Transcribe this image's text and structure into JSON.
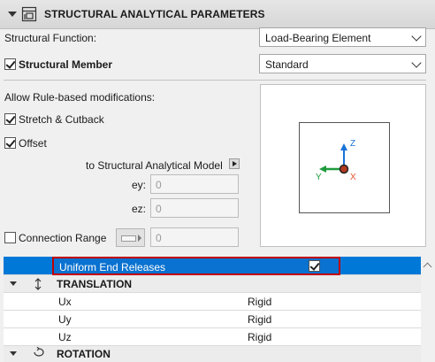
{
  "header": {
    "title": "STRUCTURAL ANALYTICAL PARAMETERS",
    "icon": "structural-panel-icon"
  },
  "structural_function": {
    "label": "Structural Function:",
    "value": "Load-Bearing Element"
  },
  "structural_member": {
    "label": "Structural Member",
    "checked": true,
    "value": "Standard"
  },
  "rule_based": {
    "label": "Allow Rule-based modifications:",
    "stretch_cutback": {
      "label": "Stretch & Cutback",
      "checked": true
    },
    "offset": {
      "label": "Offset",
      "checked": true
    },
    "to_model_label": "to Structural Analytical Model",
    "ey": {
      "label": "ey:",
      "value": "0"
    },
    "ez": {
      "label": "ez:",
      "value": "0"
    }
  },
  "connection_range": {
    "label": "Connection Range",
    "checked": false,
    "value": "0"
  },
  "preview": {
    "axis_z": "Z",
    "axis_y": "Y",
    "axis_x": "X"
  },
  "table": {
    "selected_row": {
      "label": "Uniform End Releases",
      "checked": true
    },
    "translation": {
      "label": "TRANSLATION",
      "rows": [
        {
          "name": "Ux",
          "value": "Rigid"
        },
        {
          "name": "Uy",
          "value": "Rigid"
        },
        {
          "name": "Uz",
          "value": "Rigid"
        }
      ]
    },
    "rotation": {
      "label": "ROTATION"
    }
  },
  "colors": {
    "accent": "#0078d7",
    "highlight_border": "#c00000",
    "axis_z": "#1a73d6",
    "axis_y": "#1f9a3c",
    "axis_x": "#e0522d"
  }
}
